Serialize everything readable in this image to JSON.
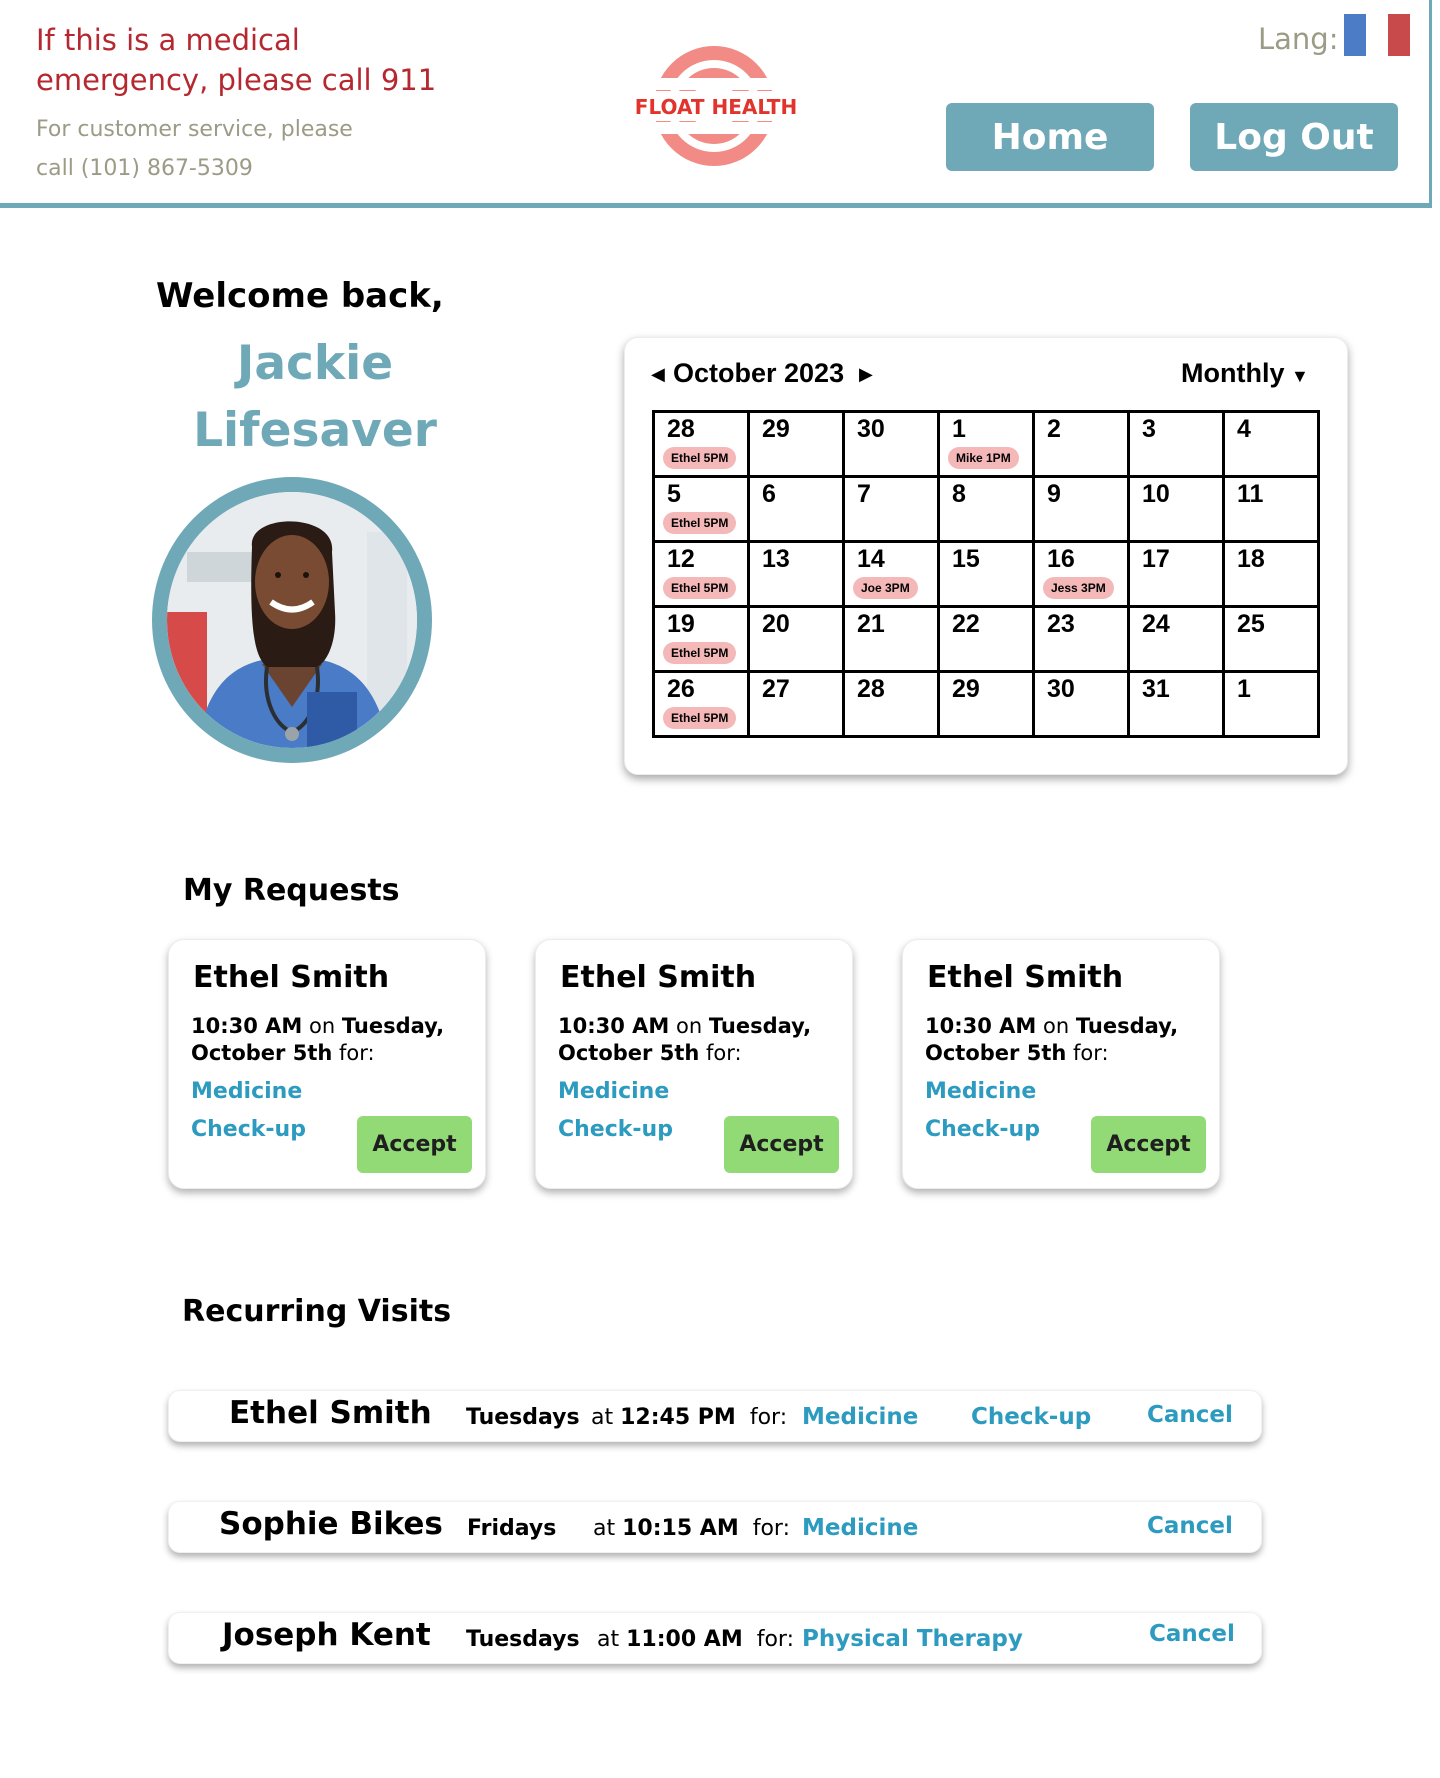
{
  "header": {
    "emergency_line1": "If this is a medical",
    "emergency_line2": "emergency, please call 911",
    "customer_service_line1": "For customer service, please",
    "customer_service_line2": "call (101) 867-5309",
    "logo_text": "FLOAT HEALTH",
    "lang_label": "Lang:",
    "home_label": "Home",
    "logout_label": "Log Out"
  },
  "welcome": {
    "greeting": "Welcome back,",
    "first_name": "Jackie",
    "last_name": "Lifesaver"
  },
  "calendar": {
    "month_label": "October 2023",
    "view_label": "Monthly",
    "weeks": [
      [
        {
          "d": "28",
          "e": "Ethel 5PM"
        },
        {
          "d": "29",
          "e": ""
        },
        {
          "d": "30",
          "e": ""
        },
        {
          "d": "1",
          "e": "Mike 1PM"
        },
        {
          "d": "2",
          "e": ""
        },
        {
          "d": "3",
          "e": ""
        },
        {
          "d": "4",
          "e": ""
        }
      ],
      [
        {
          "d": "5",
          "e": "Ethel 5PM"
        },
        {
          "d": "6",
          "e": ""
        },
        {
          "d": "7",
          "e": ""
        },
        {
          "d": "8",
          "e": ""
        },
        {
          "d": "9",
          "e": ""
        },
        {
          "d": "10",
          "e": ""
        },
        {
          "d": "11",
          "e": ""
        }
      ],
      [
        {
          "d": "12",
          "e": "Ethel 5PM"
        },
        {
          "d": "13",
          "e": ""
        },
        {
          "d": "14",
          "e": "Joe   3PM"
        },
        {
          "d": "15",
          "e": ""
        },
        {
          "d": "16",
          "e": "Jess  3PM"
        },
        {
          "d": "17",
          "e": ""
        },
        {
          "d": "18",
          "e": ""
        }
      ],
      [
        {
          "d": "19",
          "e": "Ethel 5PM"
        },
        {
          "d": "20",
          "e": ""
        },
        {
          "d": "21",
          "e": ""
        },
        {
          "d": "22",
          "e": ""
        },
        {
          "d": "23",
          "e": ""
        },
        {
          "d": "24",
          "e": ""
        },
        {
          "d": "25",
          "e": ""
        }
      ],
      [
        {
          "d": "26",
          "e": "Ethel 5PM"
        },
        {
          "d": "27",
          "e": ""
        },
        {
          "d": "28",
          "e": ""
        },
        {
          "d": "29",
          "e": ""
        },
        {
          "d": "30",
          "e": ""
        },
        {
          "d": "31",
          "e": ""
        },
        {
          "d": "1",
          "e": ""
        }
      ]
    ]
  },
  "requests": {
    "title": "My Requests",
    "items": [
      {
        "name": "Ethel Smith",
        "time": "10:30 AM",
        "on": "on",
        "day": "Tuesday,",
        "date": "October 5th",
        "for": "for:",
        "service1": "Medicine",
        "service2": "Check-up",
        "accept": "Accept"
      },
      {
        "name": "Ethel Smith",
        "time": "10:30 AM",
        "on": "on",
        "day": "Tuesday,",
        "date": "October 5th",
        "for": "for:",
        "service1": "Medicine",
        "service2": "Check-up",
        "accept": "Accept"
      },
      {
        "name": "Ethel Smith",
        "time": "10:30 AM",
        "on": "on",
        "day": "Tuesday,",
        "date": "October 5th",
        "for": "for:",
        "service1": "Medicine",
        "service2": "Check-up",
        "accept": "Accept"
      }
    ]
  },
  "recurring": {
    "title": "Recurring Visits",
    "items": [
      {
        "name": "Ethel Smith",
        "day": "Tuesdays",
        "at": "at",
        "time": "12:45 PM",
        "for": "for:",
        "service1": "Medicine",
        "service2": "Check-up",
        "cancel": "Cancel"
      },
      {
        "name": "Sophie Bikes",
        "day": "Fridays",
        "at": "at",
        "time": "10:15 AM",
        "for": "for:",
        "service1": "Medicine",
        "service2": "",
        "cancel": "Cancel"
      },
      {
        "name": "Joseph Kent",
        "day": "Tuesdays",
        "at": "at",
        "time": "11:00 AM",
        "for": "for:",
        "service1": "Physical Therapy",
        "service2": "",
        "cancel": "Cancel"
      }
    ]
  },
  "colors": {
    "accent": "#6fa9b8",
    "emergency_text": "#b5282f",
    "link": "#2d9bc0",
    "accept": "#92da76",
    "event_pill": "#f5b8b8",
    "logo": "#f28b85"
  }
}
